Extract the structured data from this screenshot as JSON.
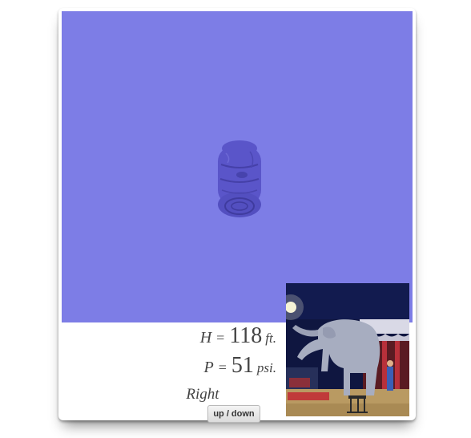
{
  "readout": {
    "height": {
      "var": "H",
      "eq": "=",
      "value": "118",
      "unit": "ft."
    },
    "pressure": {
      "var": "P",
      "eq": "=",
      "value": "51",
      "unit": "psi."
    },
    "direction": "Right"
  },
  "controls": {
    "toggle_label": "up / down"
  },
  "colors": {
    "viewport": "#7d7de6",
    "object": "#5a55c9",
    "text": "#444444"
  },
  "images": {
    "viewport_object": "rotated-barrel-shaped-object",
    "photo": "circus-elephant-on-pedestal"
  }
}
